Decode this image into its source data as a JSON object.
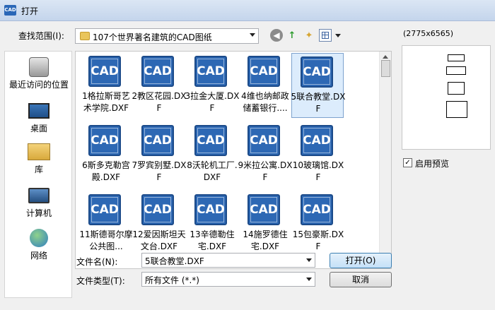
{
  "window": {
    "title": "打开",
    "app_icon": "CAD"
  },
  "lookin": {
    "label": "查找范围(I):",
    "value": "107个世界著名建筑的CAD图纸"
  },
  "places": [
    {
      "label": "最近访问的位置",
      "icon": "recent-places-icon"
    },
    {
      "label": "桌面",
      "icon": "desktop-icon"
    },
    {
      "label": "库",
      "icon": "library-icon"
    },
    {
      "label": "计算机",
      "icon": "computer-icon"
    },
    {
      "label": "网络",
      "icon": "network-icon"
    }
  ],
  "files": [
    {
      "name": "1格拉斯哥艺术学院.DXF"
    },
    {
      "name": "2教区花园.DXF"
    },
    {
      "name": "3拉金大厦.DXF"
    },
    {
      "name": "4维也纳邮政储蓄银行...."
    },
    {
      "name": "5联合教堂.DXF",
      "selected": true
    },
    {
      "name": "6斯多克勒宫殿.DXF"
    },
    {
      "name": "7罗宾别墅.DXF"
    },
    {
      "name": "8沃轮机工厂.DXF"
    },
    {
      "name": "9米拉公寓.DXF"
    },
    {
      "name": "10玻璃馆.DXF"
    },
    {
      "name": "11斯德哥尔摩公共图..."
    },
    {
      "name": "12爱因斯坦天文台.DXF"
    },
    {
      "name": "13辛德勒住宅.DXF"
    },
    {
      "name": "14施罗德住宅.DXF"
    },
    {
      "name": "15包豪斯.DXF"
    }
  ],
  "file_icon_label": "CAD",
  "preview": {
    "size": "(2775x6565)",
    "enable_label": "启用预览",
    "checked": "✓"
  },
  "filename": {
    "label": "文件名(N):",
    "value": "5联合教堂.DXF"
  },
  "filetype": {
    "label": "文件类型(T):",
    "value": "所有文件 (*.*)"
  },
  "buttons": {
    "open": "打开(O)",
    "cancel": "取消"
  }
}
